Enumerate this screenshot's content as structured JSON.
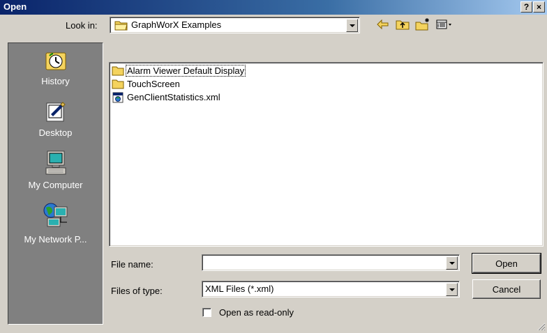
{
  "window": {
    "title": "Open",
    "help_label": "?",
    "close_label": "×"
  },
  "look_in": {
    "label": "Look in:",
    "value": "GraphWorX Examples"
  },
  "toolbar": {
    "icons": [
      "back-arrow-icon",
      "up-folder-icon",
      "new-folder-icon",
      "view-menu-icon"
    ]
  },
  "places": [
    {
      "label": "History",
      "icon": "history-icon"
    },
    {
      "label": "Desktop",
      "icon": "desktop-icon"
    },
    {
      "label": "My Computer",
      "icon": "my-computer-icon"
    },
    {
      "label": "My Network P...",
      "icon": "my-network-places-icon"
    }
  ],
  "files": [
    {
      "name": "Alarm Viewer Default Display",
      "type": "folder"
    },
    {
      "name": "TouchScreen",
      "type": "folder"
    },
    {
      "name": "GenClientStatistics.xml",
      "type": "xml-file"
    }
  ],
  "file_name": {
    "label": "File name:",
    "value": ""
  },
  "files_of_type": {
    "label": "Files of type:",
    "value": "XML Files (*.xml)"
  },
  "read_only": {
    "label": "Open as read-only",
    "checked": false
  },
  "buttons": {
    "open": "Open",
    "cancel": "Cancel"
  },
  "colors": {
    "title_bar_start": "#0a246a",
    "title_bar_end": "#a6caf0",
    "dialog_bg": "#d4d0c8",
    "places_bg": "#808080",
    "folder_yellow": "#f4d35e"
  }
}
